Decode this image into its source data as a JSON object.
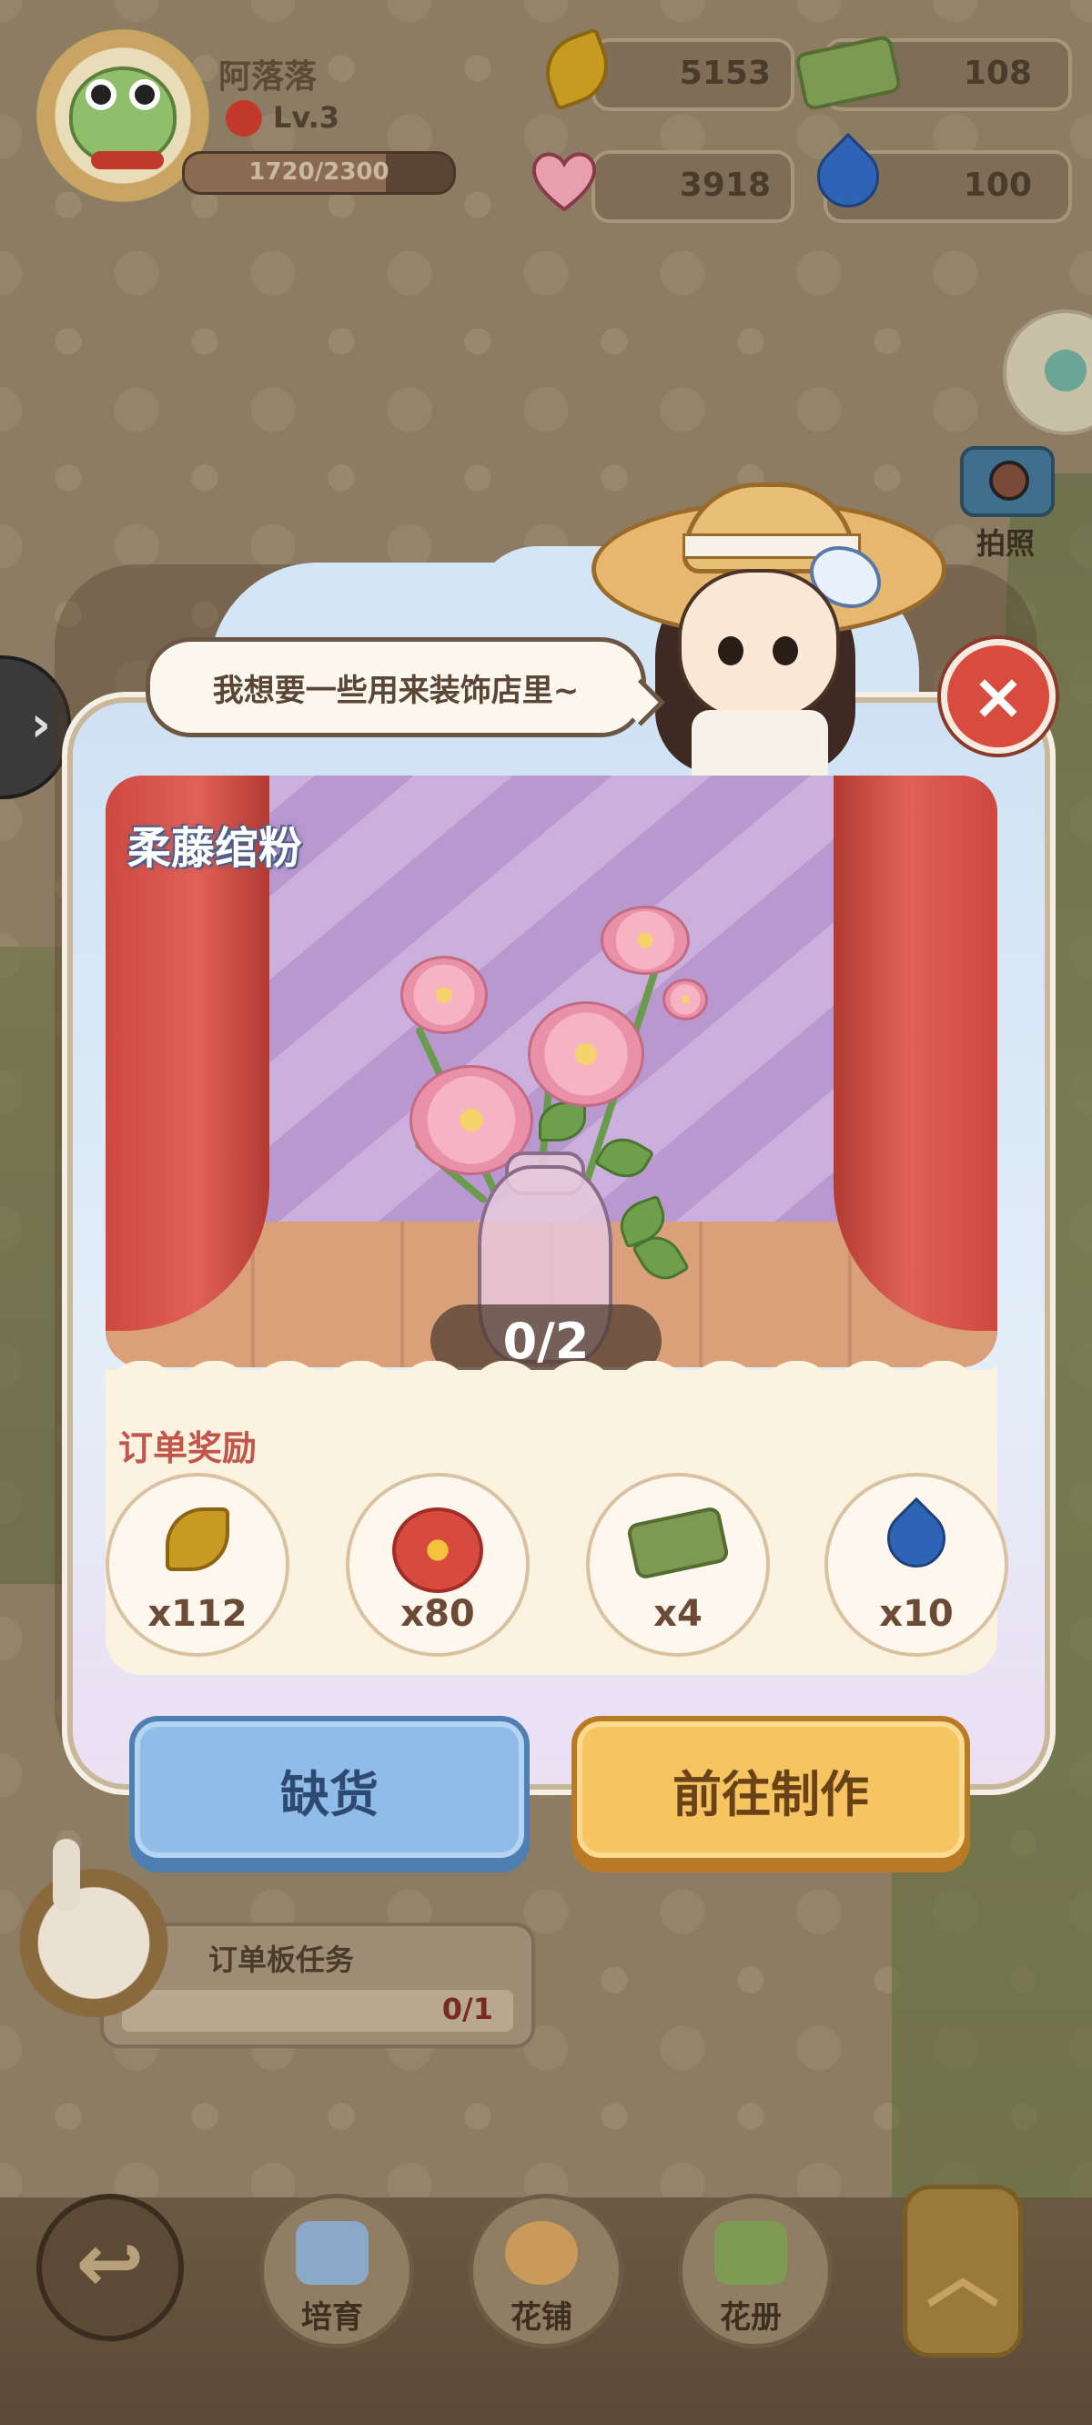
{
  "hud": {
    "player_name": "阿落落",
    "level": "Lv.3",
    "xp_text": "1720/2300",
    "xp_fraction": 0.748,
    "resources": [
      {
        "name": "leaf",
        "icon": "leaf-icon",
        "value": "5153"
      },
      {
        "name": "ticket",
        "icon": "ticket-icon",
        "value": "108"
      },
      {
        "name": "heart",
        "icon": "heart-icon",
        "value": "3918"
      },
      {
        "name": "water",
        "icon": "water-drop-icon",
        "value": "100"
      }
    ]
  },
  "side": {
    "camera_label": "拍照"
  },
  "dialog": {
    "speech": "我想要一些用来装饰店里~",
    "item_name": "柔藤绾粉",
    "progress": "0/2",
    "rewards_title": "订单奖励",
    "rewards": [
      {
        "icon": "leaf-icon",
        "qty": "x112"
      },
      {
        "icon": "red-flower-icon",
        "qty": "x80"
      },
      {
        "icon": "ticket-icon",
        "qty": "x4"
      },
      {
        "icon": "water-drop-icon",
        "qty": "x10"
      }
    ],
    "btn_out_of_stock": "缺货",
    "btn_go_make": "前往制作",
    "close_icon": "×"
  },
  "order_task": {
    "title": "订单板任务",
    "count": "0/1"
  },
  "bottom_nav": {
    "back_icon": "↩",
    "items": [
      {
        "label": "培育",
        "icon": "watering-can-icon"
      },
      {
        "label": "花铺",
        "icon": "flower-shop-icon"
      },
      {
        "label": "花册",
        "icon": "flower-book-icon"
      }
    ],
    "up_icon": "︿"
  },
  "colors": {
    "accent_red": "#d84b3f",
    "button_blue": "#8fbde8",
    "button_orange": "#f6c460"
  }
}
